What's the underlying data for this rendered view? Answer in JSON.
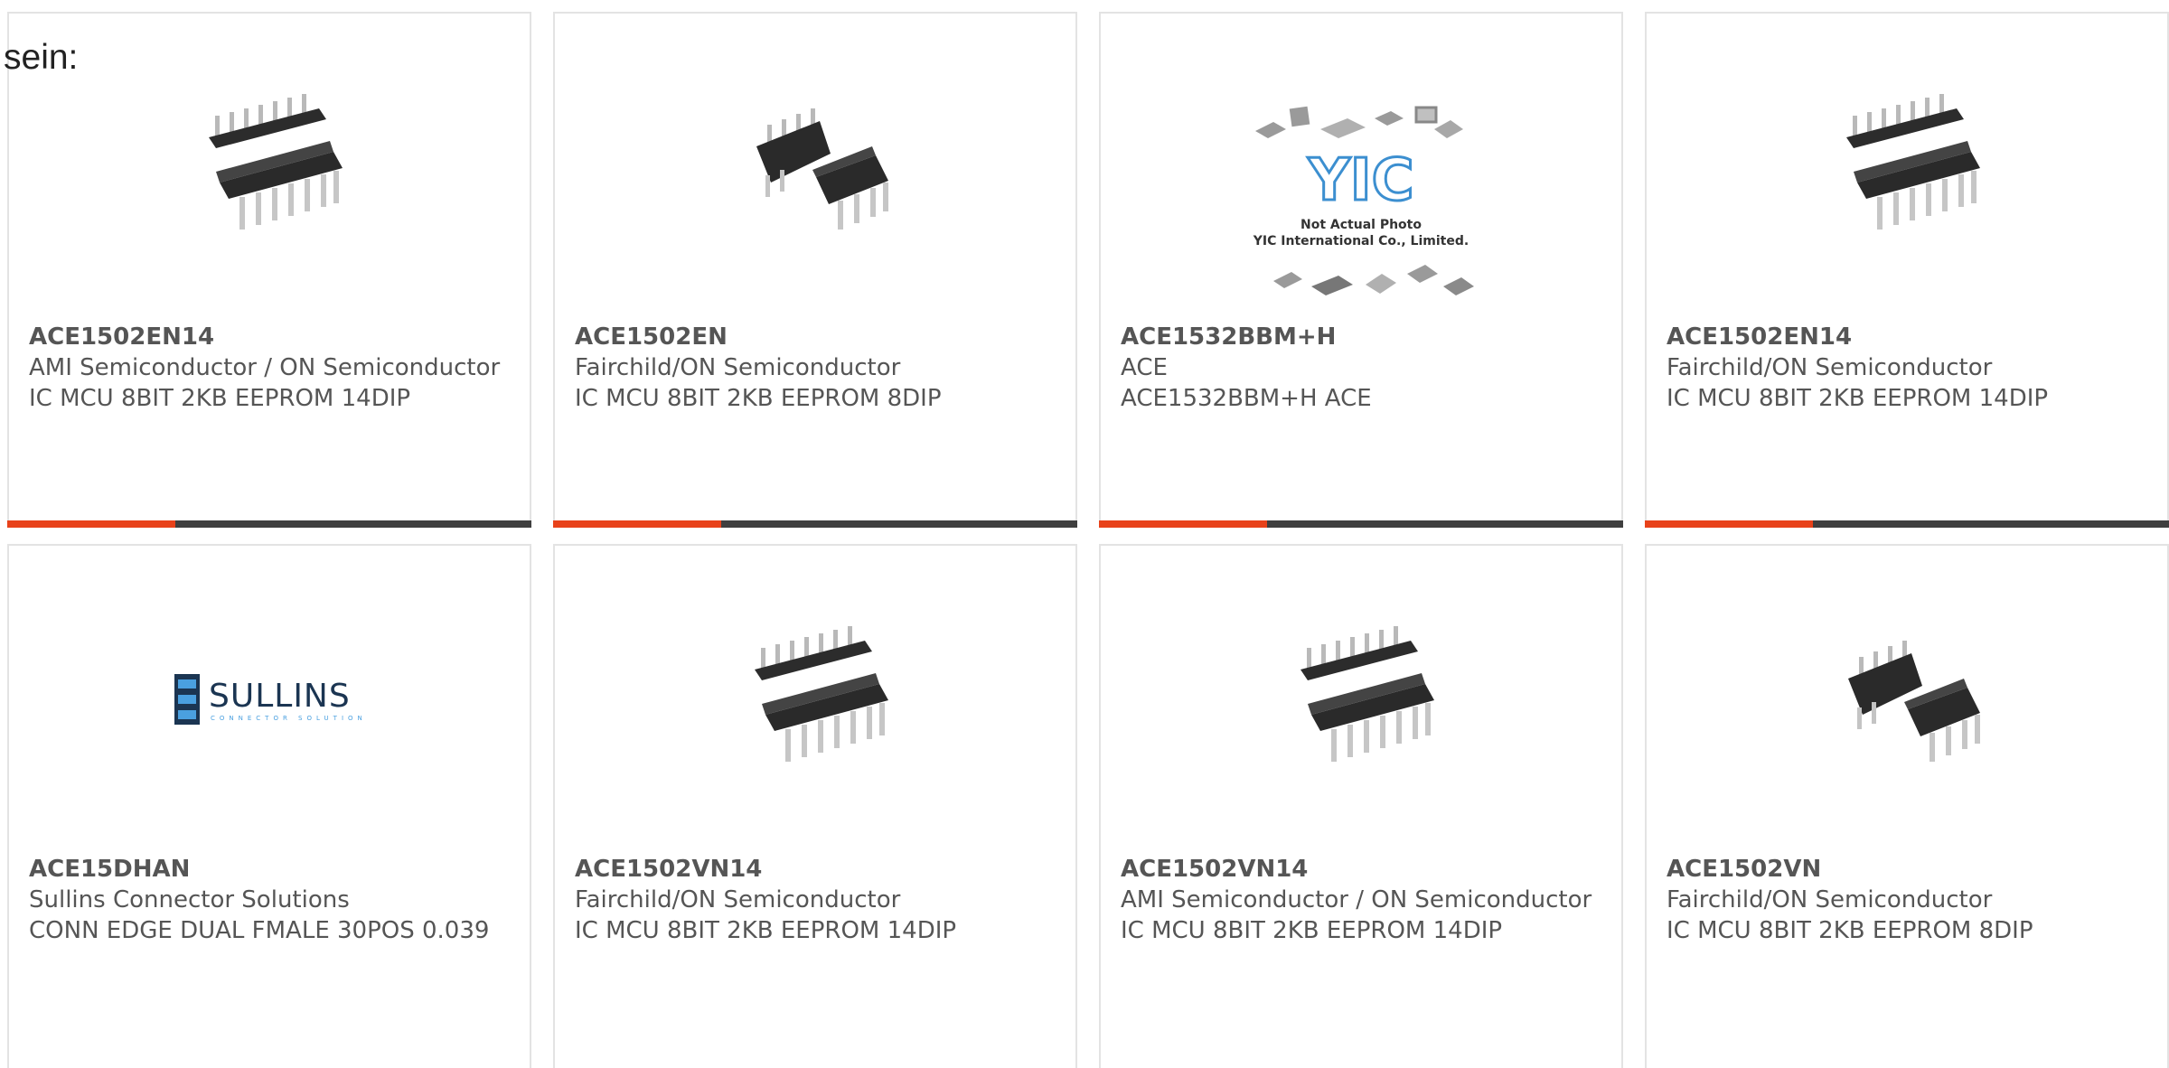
{
  "intro_text": "sein:",
  "colors": {
    "accent": "#e8421a",
    "bar": "#3f3f3f",
    "border": "#e3e3e3",
    "text": "#555555"
  },
  "products": [
    {
      "part": "ACE1502EN14",
      "manufacturer": "AMI Semiconductor / ON Semiconductor",
      "description": "IC MCU 8BIT 2KB EEPROM 14DIP",
      "image": "dip14-chip-icon"
    },
    {
      "part": "ACE1502EN",
      "manufacturer": "Fairchild/ON Semiconductor",
      "description": "IC MCU 8BIT 2KB EEPROM 8DIP",
      "image": "dip8-chip-icon"
    },
    {
      "part": "ACE1532BBM+H",
      "manufacturer": "ACE",
      "description": "ACE1532BBM+H ACE",
      "image": "yic-placeholder-icon",
      "image_text": {
        "logo": "YIC",
        "line1": "Not Actual Photo",
        "line2": "YIC International Co., Limited."
      }
    },
    {
      "part": "ACE1502EN14",
      "manufacturer": "Fairchild/ON Semiconductor",
      "description": "IC MCU 8BIT 2KB EEPROM 14DIP",
      "image": "dip14-chip-icon"
    },
    {
      "part": "ACE15DHAN",
      "manufacturer": "Sullins Connector Solutions",
      "description": "CONN EDGE DUAL FMALE 30POS 0.039",
      "image": "sullins-logo",
      "image_text": {
        "logo": "SULLINS",
        "tagline": "CONNECTOR SOLUTIONS"
      }
    },
    {
      "part": "ACE1502VN14",
      "manufacturer": "Fairchild/ON Semiconductor",
      "description": "IC MCU 8BIT 2KB EEPROM 14DIP",
      "image": "dip14-chip-icon"
    },
    {
      "part": "ACE1502VN14",
      "manufacturer": "AMI Semiconductor / ON Semiconductor",
      "description": "IC MCU 8BIT 2KB EEPROM 14DIP",
      "image": "dip14-chip-icon"
    },
    {
      "part": "ACE1502VN",
      "manufacturer": "Fairchild/ON Semiconductor",
      "description": "IC MCU 8BIT 2KB EEPROM 8DIP",
      "image": "dip8-chip-icon"
    }
  ]
}
